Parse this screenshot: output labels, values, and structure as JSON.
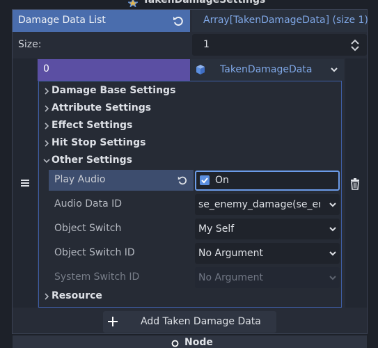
{
  "header": {
    "title": "TakenDamageSettings",
    "title_icon": "star-node-icon"
  },
  "array_property": {
    "label": "Damage Data List",
    "value_button": "Array[TakenDamageData] (size 1)",
    "size_label": "Size:",
    "size_value": "1"
  },
  "element": {
    "index": "0",
    "resource_type": "TakenDamageData",
    "sections": {
      "damage_base": "Damage Base Settings",
      "attribute": "Attribute Settings",
      "effect": "Effect Settings",
      "hit_stop": "Hit Stop Settings",
      "other": "Other Settings",
      "resource": "Resource"
    },
    "properties": {
      "play_audio": {
        "label": "Play Audio",
        "checked": true,
        "value": "On"
      },
      "audio_data_id": {
        "label": "Audio Data ID",
        "value": "se_enemy_damage(se_ene"
      },
      "object_switch": {
        "label": "Object Switch",
        "value": "My Self"
      },
      "object_switch_id": {
        "label": "Object Switch ID",
        "value": "No Argument"
      },
      "system_switch_id": {
        "label": "System Switch ID",
        "value": "No Argument"
      }
    }
  },
  "add_button": "Add Taken Damage Data",
  "footer": {
    "label": "Node"
  },
  "colors": {
    "accent": "#4a6dad",
    "element_index": "#5b4fa3",
    "link_text": "#7fa7e6",
    "checkbox": "#5b8fe0"
  }
}
